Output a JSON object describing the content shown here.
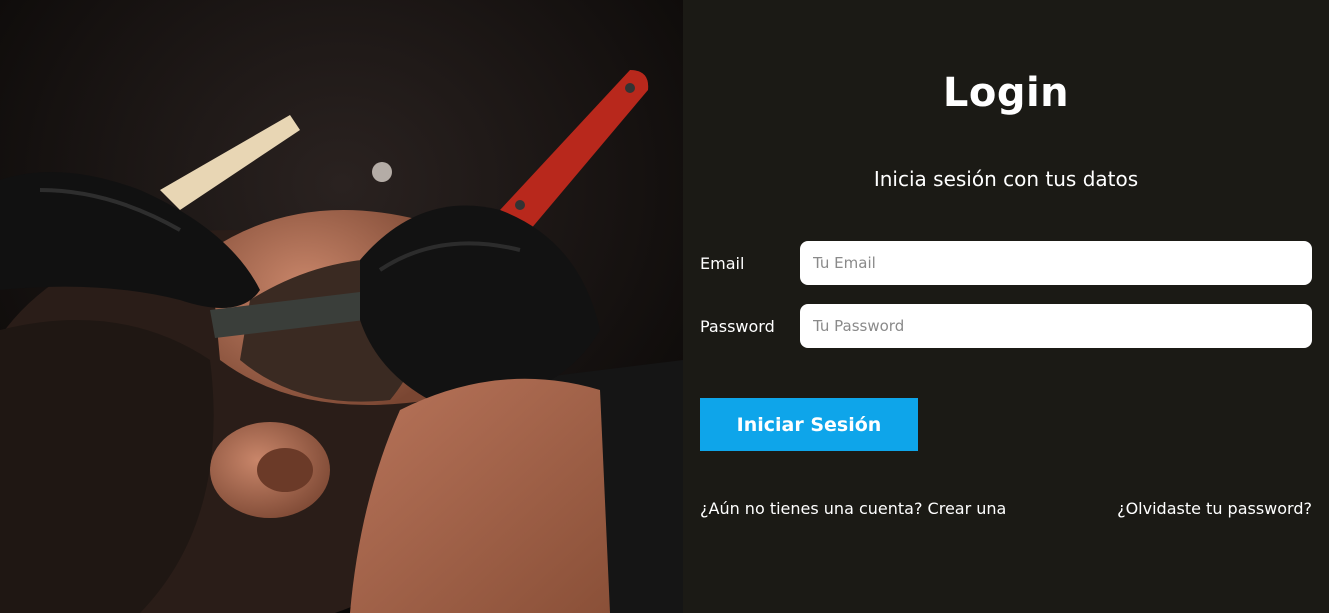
{
  "hero": {
    "image_description": "barber-shaving-client"
  },
  "login": {
    "title": "Login",
    "subtitle": "Inicia sesión con tus datos",
    "email_label": "Email",
    "email_placeholder": "Tu Email",
    "email_value": "",
    "password_label": "Password",
    "password_placeholder": "Tu Password",
    "password_value": "",
    "submit_label": "Iniciar Sesión",
    "create_account_link": "¿Aún no tienes una cuenta? Crear una",
    "forgot_password_link": "¿Olvidaste tu password?"
  },
  "colors": {
    "panel_bg": "#1b1a15",
    "accent": "#0ea5ea",
    "text": "#ffffff"
  }
}
